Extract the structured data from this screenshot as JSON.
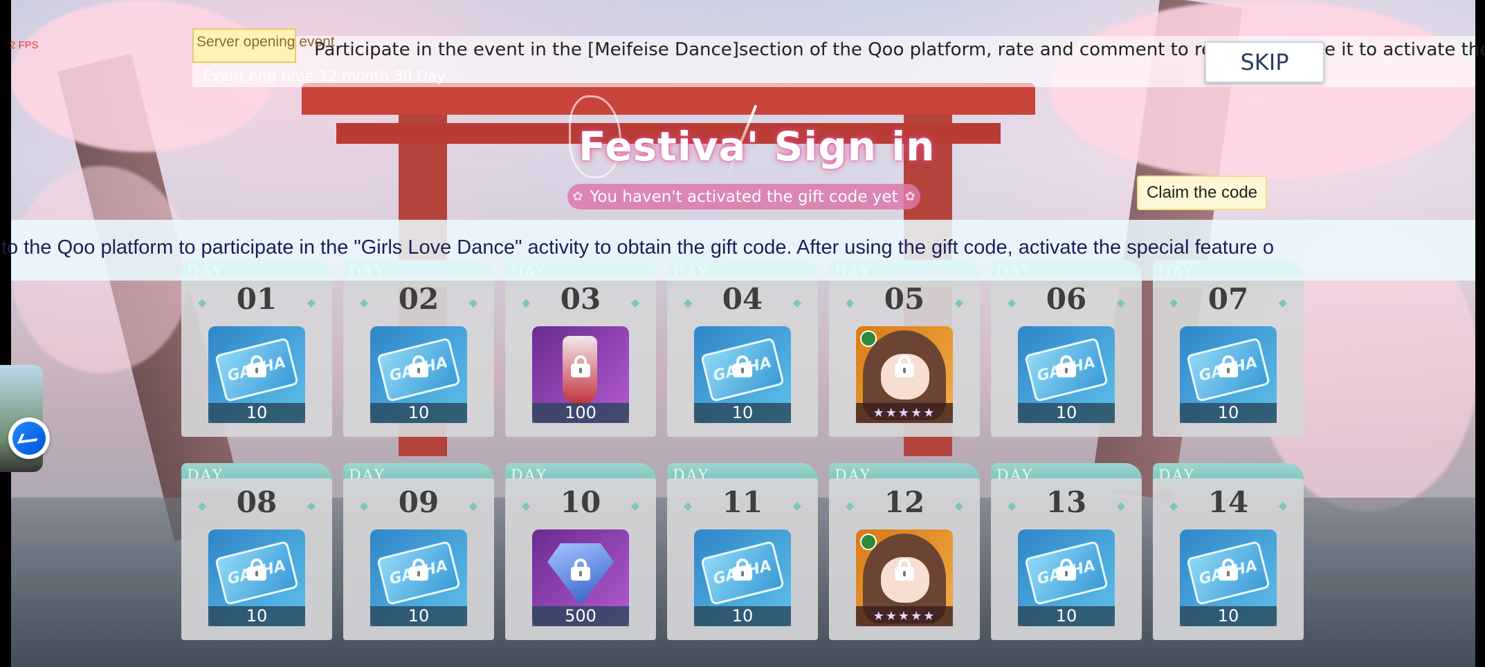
{
  "hud": {
    "fps": "2 FPS"
  },
  "event": {
    "tag": "Server opening event",
    "ticker": "Participate in the event in the [Meifeise Dance]section of the Qoo platform, rate and comment to receive the g",
    "ticker_tail": "e it to activate the",
    "end_time": "Event end time:12 month 30 Day"
  },
  "buttons": {
    "skip": "SKIP",
    "claim": "Claim the code"
  },
  "title": {
    "main": "Festiva' Sign in",
    "status": "You haven't activated the gift code yet"
  },
  "marquee": "to the Qoo platform to participate in the \"Girls Love Dance\" activity to obtain the gift code. After using the gift code, activate the special feature o",
  "day_tab_label": "DAY",
  "days": [
    {
      "day": "01",
      "item": "gacha",
      "qty": "10"
    },
    {
      "day": "02",
      "item": "gacha",
      "qty": "10"
    },
    {
      "day": "03",
      "item": "drink",
      "qty": "100"
    },
    {
      "day": "04",
      "item": "gacha",
      "qty": "10"
    },
    {
      "day": "05",
      "item": "character",
      "qty": "★★★★★"
    },
    {
      "day": "06",
      "item": "gacha",
      "qty": "10"
    },
    {
      "day": "07",
      "item": "gacha",
      "qty": "10"
    },
    {
      "day": "08",
      "item": "gacha",
      "qty": "10"
    },
    {
      "day": "09",
      "item": "gacha",
      "qty": "10"
    },
    {
      "day": "10",
      "item": "diamond",
      "qty": "500"
    },
    {
      "day": "11",
      "item": "gacha",
      "qty": "10"
    },
    {
      "day": "12",
      "item": "character",
      "qty": "★★★★★"
    },
    {
      "day": "13",
      "item": "gacha",
      "qty": "10"
    },
    {
      "day": "14",
      "item": "gacha",
      "qty": "10"
    }
  ],
  "icons": {
    "gacha": "gacha-ticket-icon",
    "lock": "lock-icon",
    "messenger": "messenger-icon"
  },
  "colors": {
    "accent_pink": "#dc78aa",
    "tab_teal": "#6dbab3",
    "skip_text": "#2d3a66"
  }
}
